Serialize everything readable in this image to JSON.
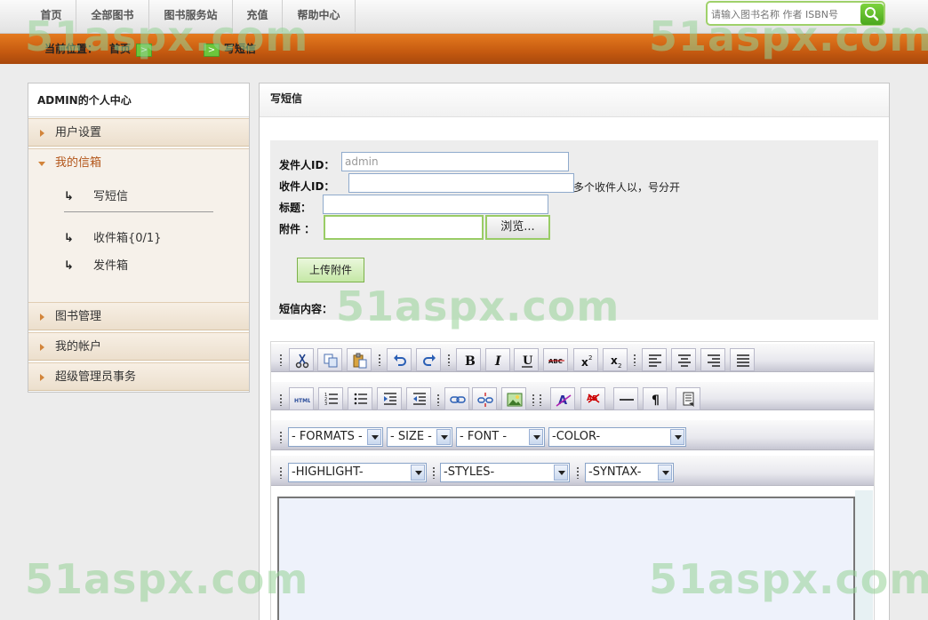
{
  "nav": {
    "items": [
      "首页",
      "全部图书",
      "图书服务站",
      "充值",
      "帮助中心"
    ],
    "search_placeholder": "请输入图书名称 作者 ISBN号",
    "search_icon": "search-icon"
  },
  "breadcrumb": {
    "label": "当前位置：",
    "home": "首页",
    "separator": ">",
    "current": "写短信"
  },
  "sidebar": {
    "title": "ADMIN的个人中心",
    "items": [
      {
        "label": "用户设置"
      },
      {
        "label": "我的信箱",
        "open": true
      },
      {
        "label": "图书管理"
      },
      {
        "label": "我的帐户"
      },
      {
        "label": "超级管理员事务"
      }
    ],
    "subitems": [
      {
        "label": "写短信"
      },
      {
        "label": "收件箱{0/1}"
      },
      {
        "label": "发件箱"
      }
    ],
    "sub_icon": "↳"
  },
  "main": {
    "title": "写短信",
    "form": {
      "sender_label": "发件人ID：",
      "sender_value": "admin",
      "receiver_label": "收件人ID：",
      "receiver_note": "多个收件人以，号分开",
      "subject_label": "标题：",
      "attach_label": "附件 ：",
      "browse_label": "浏览...",
      "upload_label": "上传附件",
      "content_label": "短信内容："
    },
    "editor": {
      "row1_icons": [
        "cut-icon",
        "copy-icon",
        "paste-icon",
        "undo-icon",
        "redo-icon",
        "bold-icon",
        "italic-icon",
        "underline-icon",
        "strikethrough-icon",
        "superscript-icon",
        "subscript-icon",
        "align-left-icon",
        "align-center-icon",
        "align-right-icon",
        "align-justify-icon"
      ],
      "row2_icons": [
        "html-icon",
        "ordered-list-icon",
        "unordered-list-icon",
        "indent-icon",
        "outdent-icon",
        "link-icon",
        "unlink-icon",
        "image-icon",
        "clean-format-icon",
        "remove-format-icon",
        "horizontal-rule-icon",
        "paragraph-icon",
        "template-icon"
      ],
      "selects": {
        "formats": "- FORMATS -",
        "size": "- SIZE -",
        "font": "- FONT -",
        "color": "-COLOR-",
        "highlight": "-HIGHLIGHT-",
        "styles": "-STYLES-",
        "syntax": "-SYNTAX-"
      }
    }
  },
  "watermark": "51aspx.com"
}
